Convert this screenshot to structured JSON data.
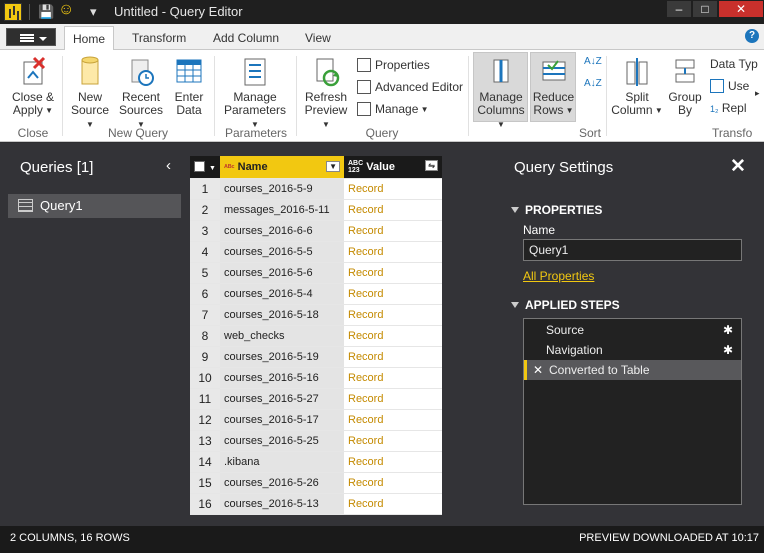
{
  "window": {
    "title": "Untitled - Query Editor",
    "minimize": "–",
    "maximize": "□",
    "close": "✕"
  },
  "quick_access": {
    "save": "💾",
    "smile": "☺",
    "dropdown": "▾"
  },
  "tabs": [
    {
      "label": "Home"
    },
    {
      "label": "Transform"
    },
    {
      "label": "Add Column"
    },
    {
      "label": "View"
    }
  ],
  "help": "?",
  "ribbon": {
    "close_apply": "Close &",
    "close_apply2": "Apply",
    "new_source": "New",
    "new_source2": "Source",
    "recent_sources": "Recent",
    "recent_sources2": "Sources",
    "enter_data": "Enter",
    "enter_data2": "Data",
    "manage_params": "Manage",
    "manage_params2": "Parameters",
    "refresh": "Refresh",
    "refresh2": "Preview",
    "properties": "Properties",
    "advanced_editor": "Advanced Editor",
    "manage": "Manage",
    "manage_columns": "Manage",
    "manage_columns2": "Columns",
    "reduce_rows": "Reduce",
    "reduce_rows2": "Rows",
    "sort_az": "A↓Z",
    "split_column": "Split",
    "split_column2": "Column",
    "group_by": "Group",
    "group_by2": "By",
    "data_type": "Data Typ",
    "use": "Use",
    "repl": "Repl",
    "groups": {
      "close": "Close",
      "new_query": "New Query",
      "parameters": "Parameters",
      "query": "Query",
      "sort": "Sort",
      "transform": "Transfo"
    }
  },
  "left_pane": {
    "title": "Queries [1]",
    "collapse": "‹",
    "items": [
      {
        "label": "Query1"
      }
    ]
  },
  "grid": {
    "headers": {
      "name": "Name",
      "value": "Value",
      "name_type": "ABC",
      "value_type": "ABC\n123"
    },
    "rows": [
      {
        "n": "1",
        "name": "courses_2016-5-9",
        "value": "Record"
      },
      {
        "n": "2",
        "name": "messages_2016-5-11",
        "value": "Record"
      },
      {
        "n": "3",
        "name": "courses_2016-6-6",
        "value": "Record"
      },
      {
        "n": "4",
        "name": "courses_2016-5-5",
        "value": "Record"
      },
      {
        "n": "5",
        "name": "courses_2016-5-6",
        "value": "Record"
      },
      {
        "n": "6",
        "name": "courses_2016-5-4",
        "value": "Record"
      },
      {
        "n": "7",
        "name": "courses_2016-5-18",
        "value": "Record"
      },
      {
        "n": "8",
        "name": "web_checks",
        "value": "Record"
      },
      {
        "n": "9",
        "name": "courses_2016-5-19",
        "value": "Record"
      },
      {
        "n": "10",
        "name": "courses_2016-5-16",
        "value": "Record"
      },
      {
        "n": "11",
        "name": "courses_2016-5-27",
        "value": "Record"
      },
      {
        "n": "12",
        "name": "courses_2016-5-17",
        "value": "Record"
      },
      {
        "n": "13",
        "name": "courses_2016-5-25",
        "value": "Record"
      },
      {
        "n": "14",
        "name": ".kibana",
        "value": "Record"
      },
      {
        "n": "15",
        "name": "courses_2016-5-26",
        "value": "Record"
      },
      {
        "n": "16",
        "name": "courses_2016-5-13",
        "value": "Record"
      }
    ]
  },
  "settings": {
    "title": "Query Settings",
    "close": "✕",
    "properties_header": "PROPERTIES",
    "name_label": "Name",
    "name_value": "Query1",
    "all_properties": "All Properties",
    "applied_steps_header": "APPLIED STEPS",
    "steps": [
      {
        "label": "Source"
      },
      {
        "label": "Navigation"
      },
      {
        "label": "Converted to Table"
      }
    ]
  },
  "status": {
    "left": "2 COLUMNS, 16 ROWS",
    "right": "PREVIEW DOWNLOADED AT 10:17"
  },
  "colors": {
    "accent": "#f2c811",
    "dark": "#333337",
    "record": "#c48a00"
  }
}
